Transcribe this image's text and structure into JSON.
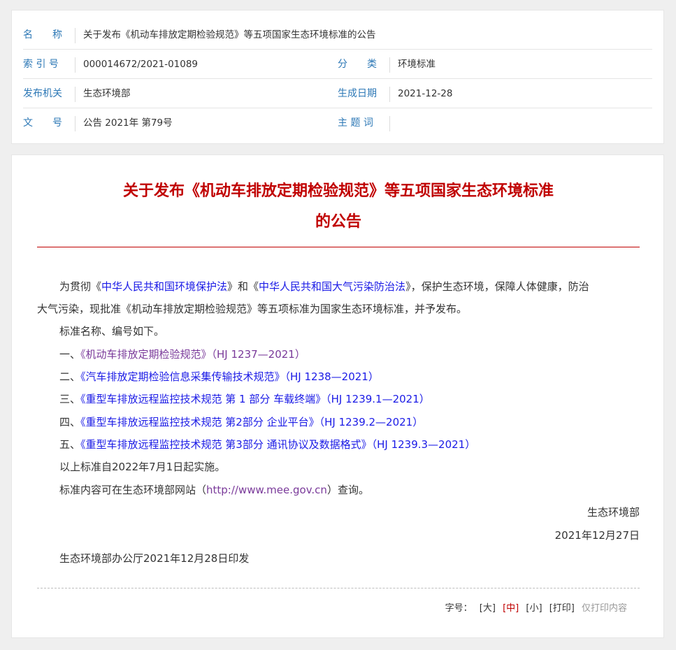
{
  "meta": {
    "labels": {
      "name": "名　　称",
      "index_no": "索 引 号",
      "category": "分　　类",
      "issuer": "发布机关",
      "date": "生成日期",
      "doc_no": "文　　号",
      "subject": "主 题 词"
    },
    "values": {
      "name": "关于发布《机动车排放定期检验规范》等五项国家生态环境标准的公告",
      "index_no": "000014672/2021-01089",
      "category": "环境标准",
      "issuer": "生态环境部",
      "date": "2021-12-28",
      "doc_no": "公告 2021年 第79号",
      "subject": ""
    }
  },
  "article": {
    "title_line1": "关于发布《机动车排放定期检验规范》等五项国家生态环境标准",
    "title_line2": "的公告",
    "para1": {
      "pre": "为贯彻《",
      "law1": "中华人民共和国环境保护法",
      "mid": "》和《",
      "law2": "中华人民共和国大气污染防治法",
      "post": "》，保护生态环境，保障人体健康，防治",
      "cont": "大气污染，现批准《机动车排放定期检验规范》等五项标准为国家生态环境标准，并予发布。"
    },
    "list_intro": "标准名称、编号如下。",
    "standards": [
      {
        "num": "一、",
        "link": "《机动车排放定期检验规范》（HJ 1237—2021）"
      },
      {
        "num": "二、",
        "link": "《汽车排放定期检验信息采集传输技术规范》（HJ 1238—2021）"
      },
      {
        "num": "三、",
        "link": "《重型车排放远程监控技术规范 第 1 部分 车载终端》（HJ 1239.1—2021）"
      },
      {
        "num": "四、",
        "link": "《重型车排放远程监控技术规范 第2部分 企业平台》（HJ 1239.2—2021）"
      },
      {
        "num": "五、",
        "link": "《重型车排放远程监控技术规范 第3部分 通讯协议及数据格式》（HJ 1239.3—2021）"
      }
    ],
    "effective": "以上标准自2022年7月1日起实施。",
    "query": {
      "pre": "标准内容可在生态环境部网站（",
      "url": "http://www.mee.gov.cn",
      "post": "）查询。"
    },
    "signature": "生态环境部",
    "sign_date": "2021年12月27日",
    "printed_by": "生态环境部办公厅2021年12月28日印发"
  },
  "tools": {
    "label": "字号：",
    "large": "[大]",
    "medium": "[中]",
    "small": "[小]",
    "print": "[打印]",
    "print_content": "仅打印内容"
  },
  "colors": {
    "label_blue": "#2d78b6",
    "title_red": "#c00000",
    "link_blue": "#1a1ae6",
    "link_visited": "#7a3a9a"
  }
}
